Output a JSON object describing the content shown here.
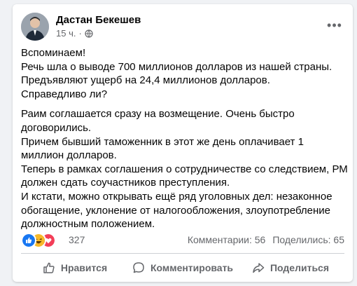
{
  "post": {
    "author": "Дастан Бекешев",
    "time": "15 ч.",
    "privacy_icon": "globe-icon",
    "paragraphs": [
      [
        "Вспоминаем!",
        "Речь шла о выводе 700 миллионов долларов из нашей страны.",
        "Предъявляют ущерб на 24,4 миллионов долларов.",
        "Справедливо ли?"
      ],
      [
        "Раим соглашается сразу на возмещение. Очень быстро",
        "договорились.",
        "Причем бывший таможенник в этот же день оплачивает 1",
        "миллион долларов.",
        "Теперь в рамках соглашения о сотрудничестве со следствием, РМ",
        "должен сдать соучастников преступления.",
        "И кстати, можно открывать ещё ряд уголовных дел: незаконное",
        "обогащение, уклонение от налогообложения, злоупотребление",
        "должностным положением."
      ]
    ]
  },
  "reactions": {
    "icons": [
      "like-reaction-icon",
      "haha-reaction-icon",
      "love-reaction-icon"
    ],
    "count": "327",
    "comments": "Комментарии: 56",
    "shares": "Поделились: 65"
  },
  "actions": {
    "like": "Нравится",
    "comment": "Комментировать",
    "share": "Поделиться"
  },
  "colors": {
    "like_blue": "#1877f2",
    "haha_yellow": "#f7b928",
    "love_red": "#f33e58",
    "muted": "#65676b"
  }
}
